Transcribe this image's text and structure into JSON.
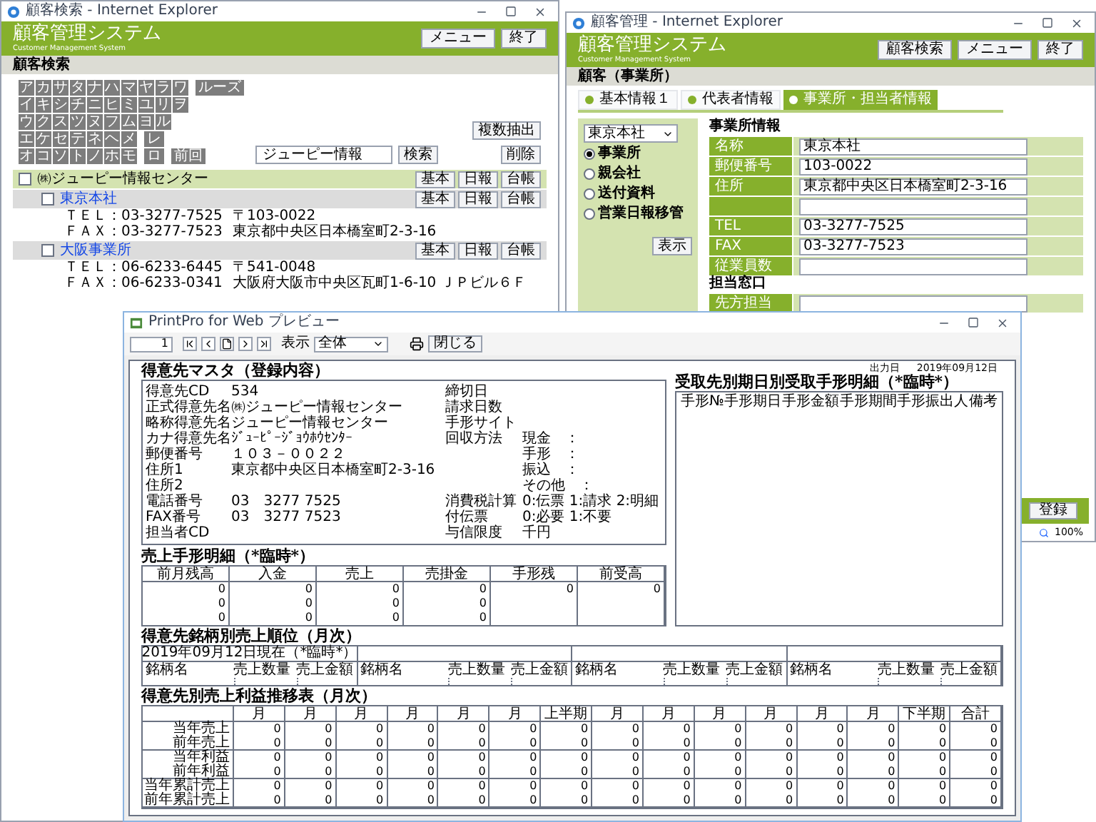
{
  "search_window": {
    "title": "顧客検索 - Internet Explorer",
    "app_title": "顧客管理システム",
    "app_subtitle": "Customer Management System",
    "header_buttons": [
      "メニュー",
      "終了"
    ],
    "section": "顧客検索",
    "kana_rows": [
      {
        "keys": [
          "ア",
          "カ",
          "サ",
          "タ",
          "ナ",
          "ハ",
          "マ",
          "ヤ",
          "ラ",
          "ワ"
        ],
        "extras": [
          "ルーズ"
        ]
      },
      {
        "keys": [
          "イ",
          "キ",
          "シ",
          "チ",
          "ニ",
          "ヒ",
          "ミ",
          "ユ",
          "リ",
          "ヲ"
        ]
      },
      {
        "keys": [
          "ウ",
          "ク",
          "ス",
          "ツ",
          "ヌ",
          "フ",
          "ム",
          "ヨ",
          "ル"
        ]
      },
      {
        "keys": [
          "エ",
          "ケ",
          "セ",
          "テ",
          "ネ",
          "ヘ",
          "メ"
        ],
        "extras": [
          "レ"
        ]
      },
      {
        "keys": [
          "オ",
          "コ",
          "ソ",
          "ト",
          "ノ",
          "ホ",
          "モ"
        ],
        "extras": [
          "ロ",
          "前回"
        ]
      }
    ],
    "search_field": {
      "value": "ジューピー情報"
    },
    "search_button": "検索",
    "side_buttons": [
      "複数抽出",
      "削除"
    ],
    "results": [
      {
        "name": "㈱ジューピー情報センター",
        "checked": false,
        "actions": [
          "基本",
          "日報",
          "台帳"
        ],
        "children": [
          {
            "name": "東京本社",
            "checked": false,
            "actions": [
              "基本",
              "日報",
              "台帳"
            ],
            "lines": [
              {
                "contact": "ＴＥＬ：03-3277-7525",
                "detail": "〒103-0022"
              },
              {
                "contact": "ＦＡＸ：03-3277-7523",
                "detail": "東京都中央区日本橋室町2-3-16"
              }
            ]
          },
          {
            "name": "大阪事業所",
            "checked": false,
            "actions": [
              "基本",
              "日報",
              "台帳"
            ],
            "lines": [
              {
                "contact": "ＴＥＬ：06-6233-6445",
                "detail": "〒541-0048"
              },
              {
                "contact": "ＦＡＸ：06-6233-0341",
                "detail": "大阪府大阪市中央区瓦町1-6-10 ＪＰビル６Ｆ"
              }
            ]
          }
        ]
      }
    ]
  },
  "office_window": {
    "title": "顧客管理 - Internet Explorer",
    "app_title": "顧客管理システム",
    "app_subtitle": "Customer Management System",
    "header_buttons": [
      "顧客検索",
      "メニュー",
      "終了"
    ],
    "section": "顧客（事業所）",
    "tabs": [
      {
        "label": "基本情報１",
        "selected": false
      },
      {
        "label": "代表者情報",
        "selected": false
      },
      {
        "label": "事業所・担当者情報",
        "selected": true
      }
    ],
    "office_select": "東京本社",
    "views": [
      {
        "label": "事業所",
        "selected": true
      },
      {
        "label": "親会社",
        "selected": false
      },
      {
        "label": "送付資料",
        "selected": false
      },
      {
        "label": "営業日報移管",
        "selected": false
      }
    ],
    "show_button": "表示",
    "groups": [
      {
        "heading": "事業所情報",
        "fields": [
          {
            "kind": "labeled",
            "label": "名称",
            "value": "東京本社"
          },
          {
            "kind": "labeled",
            "label": "郵便番号",
            "value": "103-0022"
          },
          {
            "kind": "labeled",
            "label": "住所",
            "value": "東京都中央区日本橋室町2-3-16"
          },
          {
            "kind": "blank"
          },
          {
            "kind": "labeled",
            "label": "TEL",
            "value": "03-3277-7525"
          },
          {
            "kind": "labeled",
            "label": "FAX",
            "value": "03-3277-7523"
          },
          {
            "kind": "labeled",
            "label": "従業員数"
          }
        ]
      },
      {
        "heading": "担当窓口",
        "fields": [
          {
            "kind": "labeled",
            "label": "先方担当"
          }
        ]
      }
    ],
    "submit_button": "登録",
    "zoom": "100%"
  },
  "preview_window": {
    "title": "PrintPro for Web プレビュー",
    "page": "1",
    "display_label": "表示",
    "display_select": "全体",
    "close_button": "閉じる",
    "output_date_label": "出力日",
    "output_date": "2019年09月12日",
    "master": {
      "title": "得意先マスタ（登録内容）",
      "rows": [
        {
          "label": "得意先CD",
          "value": "534",
          "right_label": "締切日"
        },
        {
          "label": "正式得意先名",
          "value": "㈱ジューピー情報センター",
          "right_label": "請求日数"
        },
        {
          "label": "略称得意先名",
          "value": "ジューピー情報センター",
          "right_label": "手形サイト"
        },
        {
          "label": "カナ得意先名",
          "value": "ｼﾞｭｰﾋﾟｰｼﾞｮｳﾎｳｾﾝﾀｰ",
          "right_label": "回収方法",
          "right_value": "現金　："
        },
        {
          "label": "郵便番号",
          "value": "１０３－００２２",
          "right_value": "手形　："
        },
        {
          "label": "住所1",
          "value": "東京都中央区日本橋室町2-3-16",
          "right_value": "振込　："
        },
        {
          "label": "住所2",
          "right_value": "その他　："
        },
        {
          "label": "電話番号",
          "value": "03　3277 7525",
          "right_label": "消費税計算",
          "right_value": "0:伝票 1:請求 2:明細"
        },
        {
          "label": "FAX番号",
          "value": "03　3277 7523",
          "right_label": "付伝票",
          "right_value": "0:必要 1:不要"
        },
        {
          "label": "担当者CD",
          "right_label": "与信限度",
          "right_value": "千円"
        }
      ]
    },
    "receivables": {
      "title": "受取先別期日別受取手形明細（*臨時*）",
      "columns": [
        "手形№",
        "手形期日",
        "手形金額",
        "手形期間",
        "手形振出人",
        "備考"
      ]
    },
    "sales_notes": {
      "title": "売上手形明細（*臨時*）",
      "columns": [
        "前月残高",
        "入金",
        "売上",
        "売掛金",
        "手形残",
        "前受高"
      ],
      "rows": [
        [
          "0",
          "0",
          "0",
          "0",
          "0",
          "0"
        ],
        [
          "0",
          "0",
          "0",
          "0"
        ],
        [
          "0",
          "0",
          "0",
          "0"
        ]
      ]
    },
    "ranking": {
      "title": "得意先銘柄別売上順位（月次）",
      "as_of": "2019年09月12日現在（*臨時*）",
      "blocks": [
        {
          "columns": [
            "銘柄名",
            "売上数量",
            "売上金額"
          ]
        },
        {
          "columns": [
            "銘柄名",
            "売上数量",
            "売上金額"
          ]
        },
        {
          "columns": [
            "銘柄名",
            "売上数量",
            "売上金額"
          ]
        },
        {
          "columns": [
            "銘柄名",
            "売上数量",
            "売上金額"
          ]
        }
      ]
    },
    "monthly": {
      "title": "得意先別売上利益推移表（月次）",
      "columns": [
        "月",
        "月",
        "月",
        "月",
        "月",
        "月",
        "上半期",
        "月",
        "月",
        "月",
        "月",
        "月",
        "月",
        "下半期",
        "合計"
      ],
      "rows": [
        {
          "label": "当年売上",
          "values": [
            "0",
            "0",
            "0",
            "0",
            "0",
            "0",
            "0",
            "0",
            "0",
            "0",
            "0",
            "0",
            "0",
            "0",
            "0"
          ]
        },
        {
          "label": "前年売上",
          "values": [
            "0",
            "0",
            "0",
            "0",
            "0",
            "0",
            "0",
            "0",
            "0",
            "0",
            "0",
            "0",
            "0",
            "0",
            "0"
          ]
        },
        {
          "label": "当年利益",
          "values": [
            "0",
            "0",
            "0",
            "0",
            "0",
            "0",
            "0",
            "0",
            "0",
            "0",
            "0",
            "0",
            "0",
            "0",
            "0"
          ]
        },
        {
          "label": "前年利益",
          "values": [
            "0",
            "0",
            "0",
            "0",
            "0",
            "0",
            "0",
            "0",
            "0",
            "0",
            "0",
            "0",
            "0",
            "0",
            "0"
          ]
        },
        {
          "label": "当年累計売上",
          "values": [
            "0",
            "0",
            "0",
            "0",
            "0",
            "0",
            "0",
            "0",
            "0",
            "0",
            "0",
            "0",
            "0",
            "0",
            "0"
          ]
        },
        {
          "label": "前年累計売上",
          "values": [
            "0",
            "0",
            "0",
            "0",
            "0",
            "0",
            "0",
            "0",
            "0",
            "0",
            "0",
            "0",
            "0",
            "0",
            "0"
          ]
        }
      ]
    }
  }
}
